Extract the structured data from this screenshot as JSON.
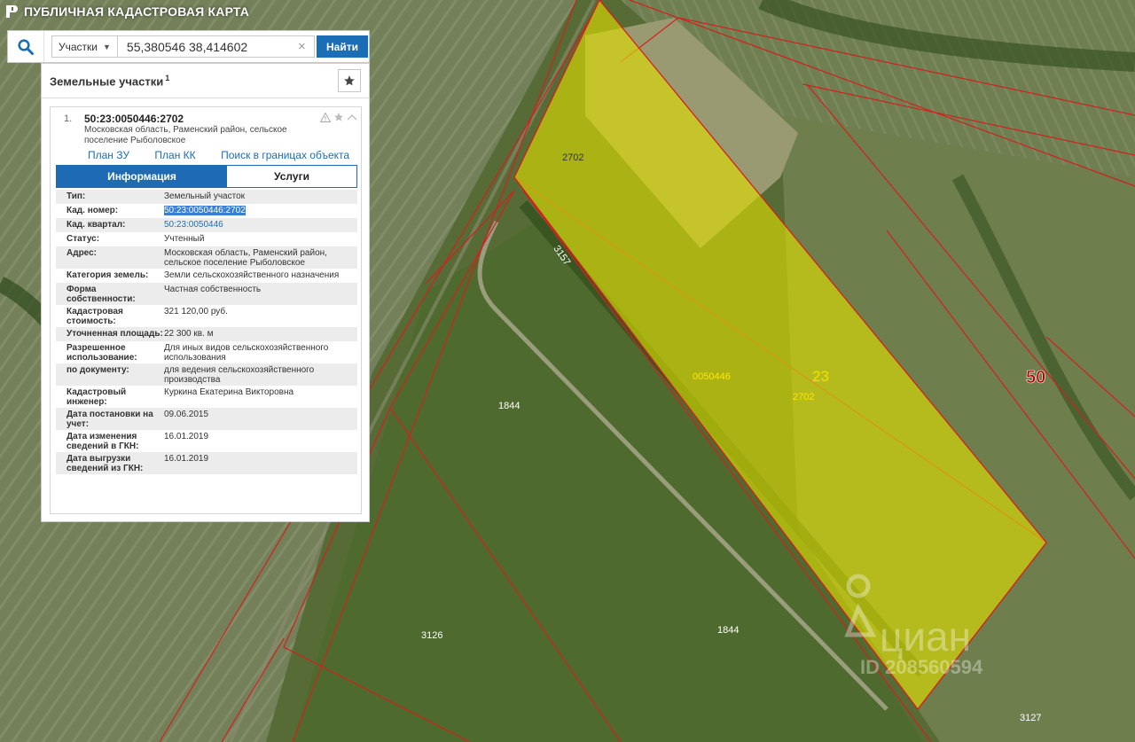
{
  "app": {
    "title": "ПУБЛИЧНАЯ КАДАСТРОВАЯ КАРТА"
  },
  "search": {
    "type_label": "Участки",
    "query": "55,380546 38,414602",
    "button_label": "Найти"
  },
  "panel": {
    "title": "Земельные участки",
    "count": "1"
  },
  "result": {
    "index": "1.",
    "cad_number": "50:23:0050446:2702",
    "address": "Московская область, Раменский район, сельское поселение Рыболовское",
    "links": [
      "План ЗУ →",
      "План КК →",
      "Поиск в границах объекта →"
    ],
    "tabs": [
      "Информация",
      "Услуги"
    ],
    "rows": [
      {
        "key": "Тип:",
        "value": "Земельный участок"
      },
      {
        "key": "Кад. номер:",
        "value": "50:23:0050446:2702"
      },
      {
        "key": "Кад. квартал:",
        "value": "50:23:0050446"
      },
      {
        "key": "Статус:",
        "value": "Учтенный"
      },
      {
        "key": "Адрес:",
        "value": "Московская область, Раменский район, сельское поселение Рыболовское"
      },
      {
        "key": "Категория земель:",
        "value": "Земли сельскохозяйственного назначения"
      },
      {
        "key": "Форма собственности:",
        "value": "Частная собственность"
      },
      {
        "key": "Кадастровая стоимость:",
        "value": "321 120,00 руб."
      },
      {
        "key": "Уточненная площадь:",
        "value": "22 300 кв. м"
      },
      {
        "key": "Разрешенное использование:",
        "value": "Для иных видов сельскохозяйственного использования"
      },
      {
        "key": "по документу:",
        "value": "для ведения сельскохозяйственного производства"
      },
      {
        "key": "Кадастровый инженер:",
        "value": "Куркина Екатерина Викторовна"
      },
      {
        "key": "Дата постановки на учет:",
        "value": "09.06.2015"
      },
      {
        "key": "Дата изменения сведений в ГКН:",
        "value": "16.01.2019"
      },
      {
        "key": "Дата выгрузки сведений из ГКН:",
        "value": "16.01.2019"
      }
    ]
  },
  "map": {
    "labels": {
      "parcel_2702_top": "2702",
      "parcel_2702_center": "2702",
      "quarter": "0050446",
      "district": "23",
      "region": "50",
      "parcel_3157": "3157",
      "parcel_1844_a": "1844",
      "parcel_1844_b": "1844",
      "parcel_3126": "3126",
      "parcel_3127": "3127"
    },
    "watermark": {
      "brand": "циан",
      "id": "ID 208560594"
    },
    "colors": {
      "highlight": "#e0e000",
      "boundary": "#d42020"
    }
  }
}
